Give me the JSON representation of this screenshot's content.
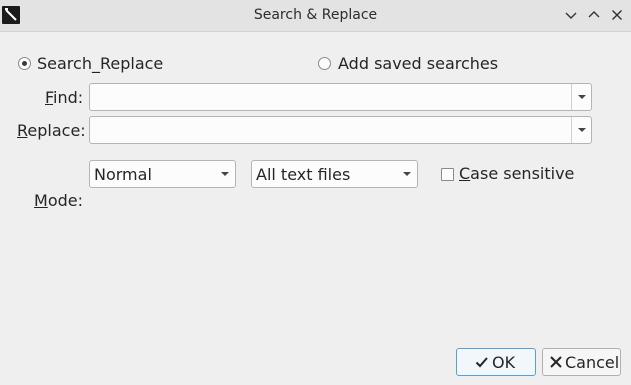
{
  "window": {
    "title": "Search & Replace"
  },
  "options": {
    "search_replace_label": "Search_Replace",
    "add_saved_label": "Add saved searches",
    "search_replace_selected": true
  },
  "fields": {
    "find_label": "Find:",
    "replace_label": "Replace:",
    "mode_label": "Mode:",
    "find_value": "",
    "replace_value": ""
  },
  "mode": {
    "mode_value": "Normal",
    "scope_value": "All text files",
    "case_label": "Case sensitive",
    "case_checked": false
  },
  "buttons": {
    "ok_label": "OK",
    "cancel_label": "Cancel"
  },
  "icons": {
    "app": "app-icon",
    "minimize": "chevron-down-icon",
    "maximize": "chevron-up-icon",
    "close": "close-icon",
    "ok": "checkmark-icon",
    "cancel": "x-icon"
  }
}
